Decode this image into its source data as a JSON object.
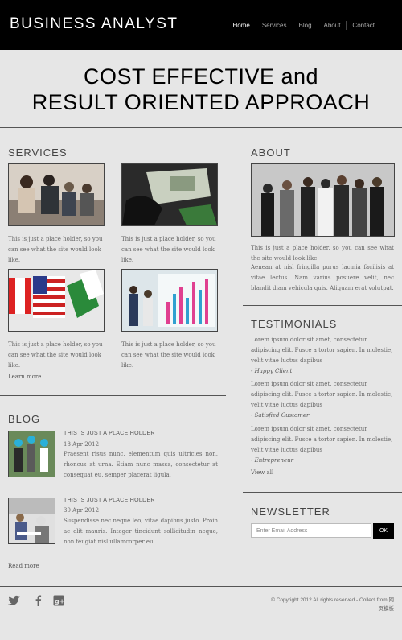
{
  "header": {
    "logo": "BUSINESS ANALYST",
    "nav": [
      "Home",
      "Services",
      "Blog",
      "About",
      "Contact"
    ]
  },
  "hero": {
    "line1": "COST EFFECTIVE and",
    "line2": "RESULT ORIENTED APPROACH"
  },
  "services": {
    "title": "SERVICES",
    "items": [
      {
        "text": "This is just a place holder, so you can see what the site would look like.",
        "image": "business-meeting-photo"
      },
      {
        "text": "This is just a place holder, so you can see what the site would look like.",
        "image": "money-puzzle-photo"
      },
      {
        "text": "This is just a place holder, so you can see what the site would look like.",
        "image": "flags-photo"
      },
      {
        "text": "This is just a place holder, so you can see what the site would look like.",
        "image": "chart-presentation-photo"
      }
    ],
    "more": "Learn more"
  },
  "blog": {
    "title": "BLOG",
    "posts": [
      {
        "title": "THIS IS JUST A PLACE HOLDER",
        "date": "18 Apr 2012",
        "excerpt": "Praesent risus nunc, elementum quis ultricies non, rhoncus at urna. Etiam nunc massa, consectetur at consequat eu, semper placerat ligula.",
        "image": "engineers-photo"
      },
      {
        "title": "THIS IS JUST A PLACE HOLDER",
        "date": "30 Apr 2012",
        "excerpt": "Suspendisse nec neque leo, vitae dapibus justo. Proin ac elit mauris. Integer tincidunt sollicitudin neque, non feugiat nisl ullamcorper eu.",
        "image": "office-meeting-photo"
      }
    ],
    "more": "Read more"
  },
  "about": {
    "title": "ABOUT",
    "image": "team-photo",
    "text1": "This is just a place holder, so you can see what the site would look like.",
    "text2": "Aenean at nisl fringilla purus lacinia facilisis at vitae lectus. Nam varius posuere velit, nec blandit diam vehicula quis. Aliquam erat volutpat."
  },
  "testimonials": {
    "title": "TESTIMONIALS",
    "items": [
      {
        "text": "Lorem ipsum dolor sit amet, consectetur adipiscing elit. Fusce a tortor sapien. In molestie, velit vitae luctus dapibus",
        "author": "- Happy Client"
      },
      {
        "text": "Lorem ipsum dolor sit amet, consectetur adipiscing elit. Fusce a tortor sapien. In molestie, velit vitae luctus dapibus",
        "author": "- Satisfied Customer"
      },
      {
        "text": "Lorem ipsum dolor sit amet, consectetur adipiscing elit. Fusce a tortor sapien. In molestie, velit vitae luctus dapibus",
        "author": "- Entrepreneur"
      }
    ],
    "view_all": "View all"
  },
  "newsletter": {
    "title": "NEWSLETTER",
    "placeholder": "Enter Email Address",
    "button": "OK"
  },
  "footer": {
    "social": [
      "twitter-icon",
      "facebook-icon",
      "google-plus-icon"
    ],
    "copyright_line1": "© Copyright 2012  All rights reserved - Collect from 网",
    "copyright_line2": "页模板"
  }
}
